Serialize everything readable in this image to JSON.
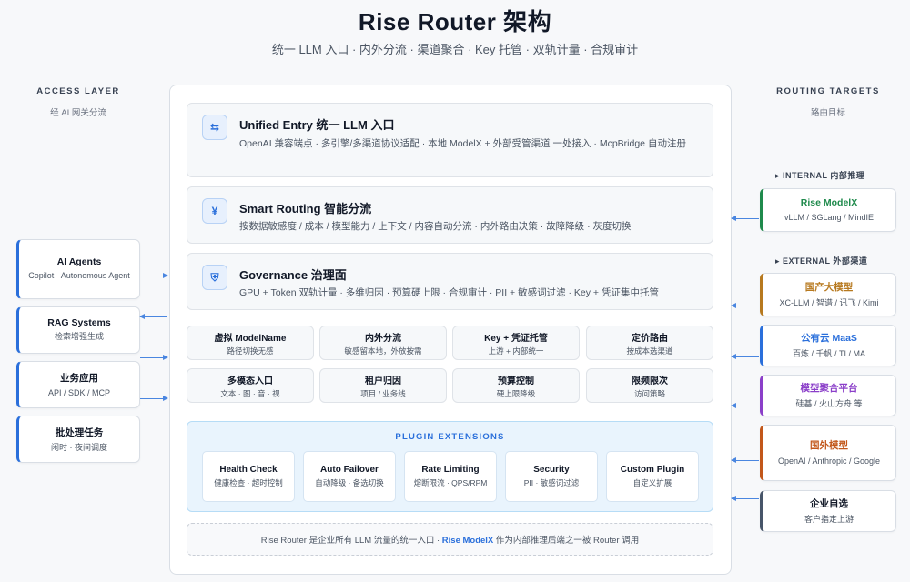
{
  "title": "Rise Router 架构",
  "subtitle": "统一 LLM 入口 · 内外分流 · 渠道聚合 · Key 托管 · 双轨计量 · 合规审计",
  "access": {
    "heading": "ACCESS LAYER",
    "subheading": "经 AI 网关分流",
    "items": [
      {
        "title": "AI Agents",
        "desc": "Copilot · Autonomous Agent"
      },
      {
        "title": "RAG Systems",
        "desc": "检索增强生成"
      },
      {
        "title": "业务应用",
        "desc": "API / SDK / MCP"
      },
      {
        "title": "批处理任务",
        "desc": "闲时 · 夜间调度"
      }
    ]
  },
  "routing": {
    "heading": "ROUTING TARGETS",
    "subheading": "路由目标",
    "internal_label": "▸ INTERNAL 内部推理",
    "external_label": "▸ EXTERNAL 外部渠道",
    "internal": [
      {
        "title": "Rise ModelX",
        "desc": "vLLM / SGLang / MindIE",
        "color": "#1f8a4c"
      }
    ],
    "external": [
      {
        "title": "国产大模型",
        "desc": "XC-LLM / 智谱 / 讯飞 / Kimi",
        "color": "#b7791f"
      },
      {
        "title": "公有云 MaaS",
        "desc": "百炼 / 千帆 / TI / MA",
        "color": "#2a6fdb"
      },
      {
        "title": "模型聚合平台",
        "desc": "硅基 / 火山方舟 等",
        "color": "#8b3fc9"
      },
      {
        "title": "国外模型",
        "desc": "OpenAI / Anthropic / Google",
        "color": "#c2571a"
      },
      {
        "title": "企业自选",
        "desc": "客户指定上游",
        "color": "#475569"
      }
    ]
  },
  "layers": [
    {
      "icon": "⇆",
      "icon_name": "swap-icon",
      "title": "Unified Entry 统一 LLM 入口",
      "desc": "OpenAI 兼容端点 · 多引擎/多渠道协议适配 · 本地 ModelX + 外部受管渠道 一处接入 · McpBridge 自动注册"
    },
    {
      "icon": "¥",
      "icon_name": "yen-icon",
      "title": "Smart Routing 智能分流",
      "desc": "按数据敏感度 / 成本 / 模型能力 / 上下文 / 内容自动分流 · 内外路由决策 · 故障降级 · 灰度切换"
    },
    {
      "icon": "⛨",
      "icon_name": "shield-icon",
      "title": "Governance 治理面",
      "desc": "GPU + Token 双轨计量 · 多维归因 · 预算硬上限 · 合规审计 · PII + 敏感词过滤 · Key + 凭证集中托管"
    }
  ],
  "features": [
    {
      "title": "虚拟 ModelName",
      "desc": "路径切换无感"
    },
    {
      "title": "内外分流",
      "desc": "敏感留本地，外放按需"
    },
    {
      "title": "Key + 凭证托管",
      "desc": "上游 + 内部统一"
    },
    {
      "title": "定价路由",
      "desc": "按成本选渠道"
    },
    {
      "title": "多模态入口",
      "desc": "文本 · 图 · 音 · 视"
    },
    {
      "title": "租户归因",
      "desc": "项目 / 业务线"
    },
    {
      "title": "预算控制",
      "desc": "硬上限降级"
    },
    {
      "title": "限频限次",
      "desc": "访问策略"
    }
  ],
  "plugins": {
    "title": "PLUGIN EXTENSIONS",
    "items": [
      {
        "title": "Health Check",
        "desc": "健康检查 · 超时控制"
      },
      {
        "title": "Auto Failover",
        "desc": "自动降级 · 备选切换"
      },
      {
        "title": "Rate Limiting",
        "desc": "熔断限流 · QPS/RPM"
      },
      {
        "title": "Security",
        "desc": "PII · 敏感词过滤"
      },
      {
        "title": "Custom Plugin",
        "desc": "自定义扩展"
      }
    ]
  },
  "footer": {
    "before": "Rise Router 是企业所有 LLM 流量的统一入口 · ",
    "highlight": "Rise ModelX",
    "after": " 作为内部推理后端之一被 Router 调用"
  },
  "colors": {
    "accent": "#2a6fdb",
    "arrow": "#4a86e0"
  }
}
